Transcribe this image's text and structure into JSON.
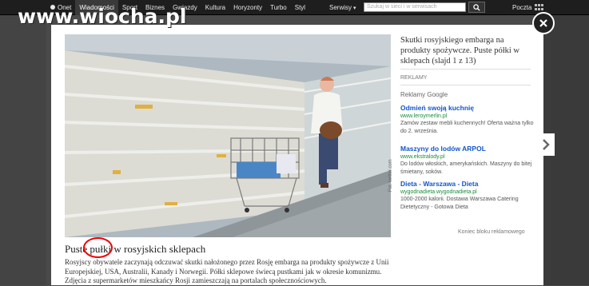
{
  "topbar": {
    "logo": "Onet",
    "nav": [
      "Wiadomości",
      "Sport",
      "Biznes",
      "Gwiazdy",
      "Kultura",
      "Horyzonty",
      "Turbo",
      "Styl"
    ],
    "active_index": 0,
    "serwisy": "Serwisy",
    "search_placeholder": "Szukaj w sieci i w serwisach",
    "poczta": "Poczta"
  },
  "watermark": "www.wiocha.pl",
  "gallery": {
    "title": "Skutki rosyjskiego embarga na produkty spożywcze. Puste półki w sklepach (slajd 1 z 13)",
    "photo_credit": "Fot. twitter.com",
    "caption_title_pre": "Puste ",
    "caption_title_circled": "pułki",
    "caption_title_post": " w rosyjskich sklepach",
    "caption_text": "Rosyjscy obywatele zaczynają odczuwać skutki nałożonego przez Rosję embarga na produkty spożywcze z Unii Europejskiej, USA, Australii, Kanady i Norwegii. Półki sklepowe świecą pustkami jak w okresie komunizmu. Zdjęcia z supermarketów mieszkańcy Rosji zamieszczają na portalach społecznościowych."
  },
  "ads": {
    "label": "REKLAMY",
    "google": "Reklamy Google",
    "items": [
      {
        "title": "Odmień swoją kuchnię",
        "url": "www.leroymerlin.pl",
        "desc": "Zamów zestaw mebli kuchennych! Oferta ważna tylko do 2. września."
      },
      {
        "title": "Maszyny do lodów ARPOL",
        "url": "www.ekstralody.pl",
        "desc": "Do lodów włoskich, amerykańskich. Maszyny do bitej śmietany, soków."
      },
      {
        "title": "Dieta - Warszawa - Dieta",
        "url": "wygodnadieta.wygodnadieta.pl",
        "desc": "1000-2000 kalorii. Dostawa Warszawa Catering Dietetyczny - Gotowa Dieta"
      }
    ],
    "end_label": "Koniec bloku reklamowego"
  }
}
